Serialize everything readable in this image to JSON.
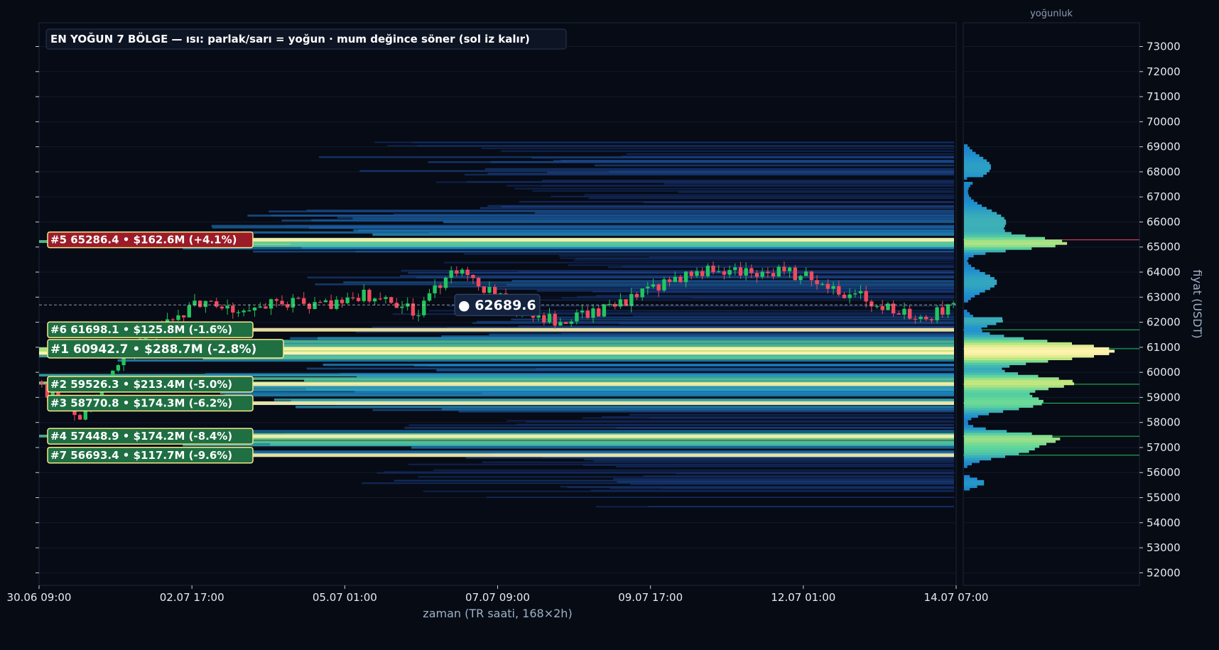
{
  "title": "EN YOĞUN 7 BÖLGE — ısı: parlak/sarı = yoğun · mum değince söner (sol iz kalır)",
  "current_price_label": "● 62689.6",
  "profile_title": "yoğunluk",
  "colors": {
    "background": "#070c14",
    "bullish": "#22c55e",
    "bearish": "#f04a5e",
    "zone_green": "#1f6f43",
    "zone_red": "#9b1c28",
    "zone_border": "#f7e98b",
    "heat_low": "#0e2250",
    "heat_mid": "#1f8fd0",
    "heat_high": "#7fe08f",
    "heat_max": "#fff0a8"
  },
  "chart_data": {
    "type": "heatmap",
    "title": "EN YOĞUN 7 BÖLGE — ısı: parlak/sarı = yoğun · mum değince söner (sol iz kalır)",
    "xlabel": "zaman (TR saati, 168×2h)",
    "ylabel": "fiyat (USDT)",
    "x_ticks": [
      "30.06 09:00",
      "02.07 17:00",
      "05.07 01:00",
      "07.07 09:00",
      "09.07 17:00",
      "12.07 01:00",
      "14.07 07:00"
    ],
    "y_ticks": [
      52000,
      53000,
      54000,
      55000,
      56000,
      57000,
      58000,
      59000,
      60000,
      61000,
      62000,
      63000,
      64000,
      65000,
      66000,
      67000,
      68000,
      69000,
      70000,
      71000,
      72000,
      73000
    ],
    "ylim": [
      51500,
      73950
    ],
    "current_price": 62689.6,
    "zones": [
      {
        "label": "#5  65286.4  •  $162.6M  (+4.1%)",
        "price": 65286.4,
        "volume_musd": 162.6,
        "pct": 4.1,
        "side": "above"
      },
      {
        "label": "#6  61698.1  •  $125.8M  (-1.6%)",
        "price": 61698.1,
        "volume_musd": 125.8,
        "pct": -1.6,
        "side": "below"
      },
      {
        "label": "#1  60942.7  •  $288.7M  (-2.8%)",
        "price": 60942.7,
        "volume_musd": 288.7,
        "pct": -2.8,
        "side": "below"
      },
      {
        "label": "#2  59526.3  •  $213.4M  (-5.0%)",
        "price": 59526.3,
        "volume_musd": 213.4,
        "pct": -5.0,
        "side": "below"
      },
      {
        "label": "#3  58770.8  •  $174.3M  (-6.2%)",
        "price": 58770.8,
        "volume_musd": 174.3,
        "pct": -6.2,
        "side": "below"
      },
      {
        "label": "#4  57448.9  •  $174.2M  (-8.4%)",
        "price": 57448.9,
        "volume_musd": 174.2,
        "pct": -8.4,
        "side": "below"
      },
      {
        "label": "#7  56693.4  •  $117.7M  (-9.6%)",
        "price": 56693.4,
        "volume_musd": 117.7,
        "pct": -9.6,
        "side": "below"
      }
    ],
    "price_path": [
      {
        "t": 0,
        "p": 59600
      },
      {
        "t": 4,
        "p": 58800
      },
      {
        "t": 8,
        "p": 58300
      },
      {
        "t": 12,
        "p": 59200
      },
      {
        "t": 16,
        "p": 60800
      },
      {
        "t": 22,
        "p": 61900
      },
      {
        "t": 26,
        "p": 62200
      },
      {
        "t": 30,
        "p": 62800
      },
      {
        "t": 34,
        "p": 62500
      },
      {
        "t": 40,
        "p": 62600
      },
      {
        "t": 48,
        "p": 62800
      },
      {
        "t": 54,
        "p": 62700
      },
      {
        "t": 60,
        "p": 63100
      },
      {
        "t": 64,
        "p": 62900
      },
      {
        "t": 70,
        "p": 62300
      },
      {
        "t": 74,
        "p": 63600
      },
      {
        "t": 78,
        "p": 64200
      },
      {
        "t": 82,
        "p": 63300
      },
      {
        "t": 88,
        "p": 62600
      },
      {
        "t": 96,
        "p": 62000
      },
      {
        "t": 102,
        "p": 62400
      },
      {
        "t": 108,
        "p": 62800
      },
      {
        "t": 114,
        "p": 63400
      },
      {
        "t": 120,
        "p": 64000
      },
      {
        "t": 128,
        "p": 64100
      },
      {
        "t": 136,
        "p": 64000
      },
      {
        "t": 142,
        "p": 63800
      },
      {
        "t": 148,
        "p": 63200
      },
      {
        "t": 154,
        "p": 62800
      },
      {
        "t": 160,
        "p": 62200
      },
      {
        "t": 164,
        "p": 62300
      },
      {
        "t": 168,
        "p": 62690
      }
    ]
  }
}
